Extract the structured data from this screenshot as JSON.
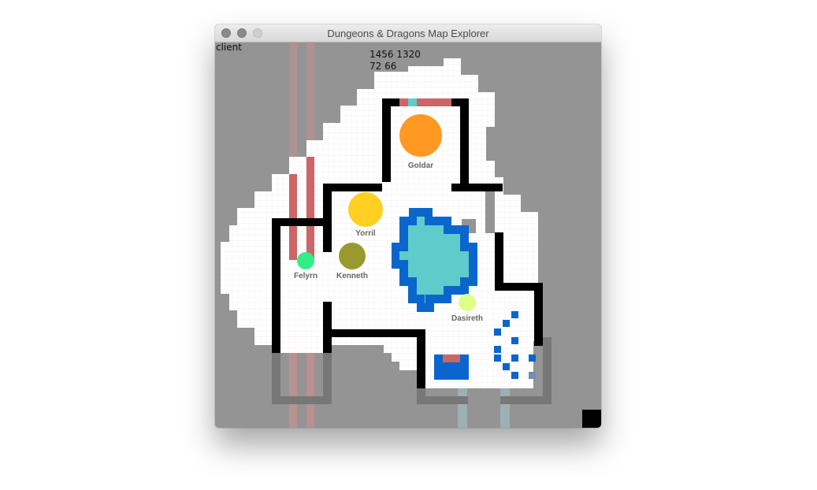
{
  "window": {
    "title": "Dungeons & Dragons Map Explorer"
  },
  "client_label": "client",
  "coords": {
    "line1": "1456 1320",
    "line2": "72 66"
  },
  "colors": {
    "background": "#949494",
    "floor": "#ffffff",
    "wall": "#000000",
    "door": "#cc6666",
    "water": "#5fcbcb",
    "water_edge": "#0a66cc",
    "grid": "#f3e9e9"
  },
  "tokens": [
    {
      "name": "Goldar",
      "color": "#ff9922"
    },
    {
      "name": "Yorril",
      "color": "#ffd022"
    },
    {
      "name": "Kenneth",
      "color": "#999930"
    },
    {
      "name": "Felyrn",
      "color": "#33ee88"
    },
    {
      "name": "Dasireth",
      "color": "#ddff88"
    }
  ]
}
